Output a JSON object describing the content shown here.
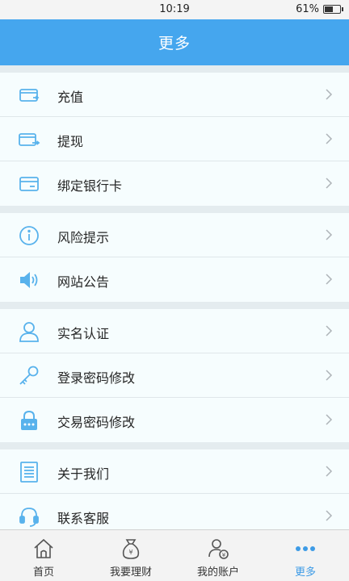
{
  "status_bar": {
    "time": "10:19",
    "battery": "61%",
    "battery_level": 0.61
  },
  "header": {
    "title": "更多"
  },
  "groups": [
    {
      "items": [
        {
          "label": "充值",
          "icon": "card-in-icon"
        },
        {
          "label": "提现",
          "icon": "card-out-icon"
        },
        {
          "label": "绑定银行卡",
          "icon": "bank-card-icon"
        }
      ]
    },
    {
      "items": [
        {
          "label": "风险提示",
          "icon": "info-icon"
        },
        {
          "label": "网站公告",
          "icon": "speaker-icon"
        }
      ]
    },
    {
      "items": [
        {
          "label": "实名认证",
          "icon": "user-icon"
        },
        {
          "label": "登录密码修改",
          "icon": "key-icon"
        },
        {
          "label": "交易密码修改",
          "icon": "lock-icon"
        }
      ]
    },
    {
      "items": [
        {
          "label": "关于我们",
          "icon": "document-icon"
        },
        {
          "label": "联系客服",
          "icon": "headset-icon"
        }
      ]
    }
  ],
  "tabbar": {
    "tabs": [
      {
        "label": "首页",
        "icon": "home-icon",
        "active": false
      },
      {
        "label": "我要理财",
        "icon": "money-bag-icon",
        "active": false
      },
      {
        "label": "我的账户",
        "icon": "account-icon",
        "active": false
      },
      {
        "label": "更多",
        "icon": "more-icon",
        "active": true
      }
    ]
  },
  "colors": {
    "header": "#45a6ee",
    "icon": "#58b2ec",
    "active_tab": "#3d9be6",
    "background": "#e4ecef",
    "row": "#f6fdfe"
  }
}
